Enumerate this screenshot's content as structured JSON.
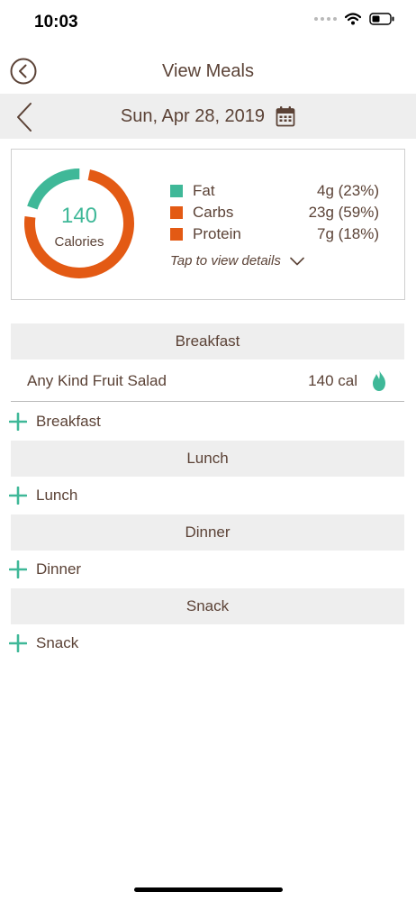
{
  "status": {
    "time": "10:03",
    "icons": [
      "signal-dots-icon",
      "wifi-icon",
      "battery-icon"
    ]
  },
  "nav": {
    "title": "View Meals",
    "back_icon": "circle-back-icon"
  },
  "date_bar": {
    "date": "Sun, Apr 28, 2019",
    "prev_icon": "chevron-left-icon",
    "calendar_icon": "calendar-icon"
  },
  "summary": {
    "calories_value": "140",
    "calories_label": "Calories",
    "macros": [
      {
        "name": "Fat",
        "value": "4g (23%)",
        "fraction": 0.23,
        "color": "#3fb898"
      },
      {
        "name": "Carbs",
        "value": "23g (59%)",
        "fraction": 0.59,
        "color": "#e35a14"
      },
      {
        "name": "Protein",
        "value": "7g (18%)",
        "fraction": 0.18,
        "color": "#e35a14"
      }
    ],
    "details_link": "Tap to view details",
    "details_icon": "chevron-down-icon"
  },
  "meals": [
    {
      "title": "Breakfast",
      "add_label": "Breakfast",
      "items": [
        {
          "name": "Any Kind Fruit Salad",
          "calories": "140 cal",
          "icon": "flame-icon"
        }
      ]
    },
    {
      "title": "Lunch",
      "add_label": "Lunch",
      "items": []
    },
    {
      "title": "Dinner",
      "add_label": "Dinner",
      "items": []
    },
    {
      "title": "Snack",
      "add_label": "Snack",
      "items": []
    }
  ],
  "colors": {
    "accent_green": "#3fb898",
    "accent_orange": "#e35a14",
    "text_brown": "#5b4236",
    "section_gray": "#eeeeee"
  }
}
